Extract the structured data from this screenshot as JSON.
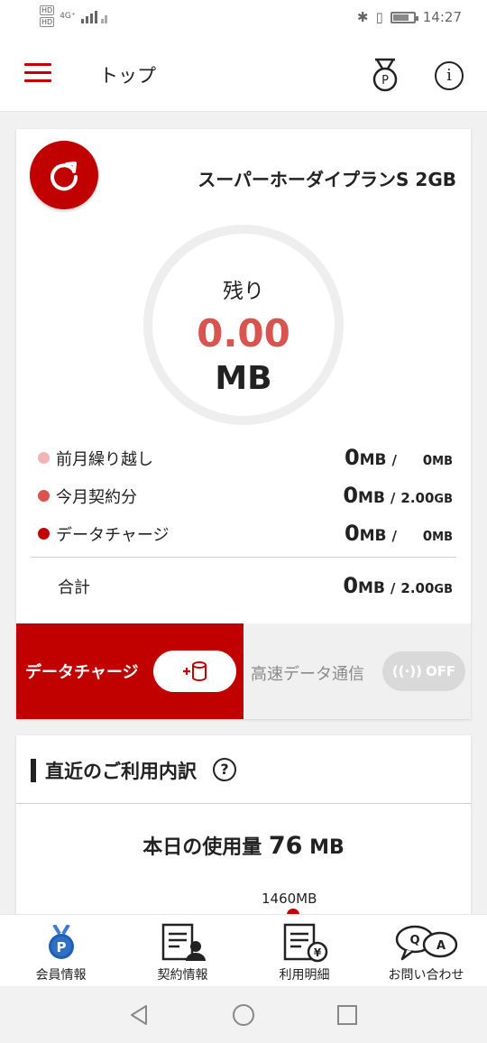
{
  "status_bar": {
    "network": "4G⁺",
    "time": "14:27"
  },
  "header": {
    "title": "トップ"
  },
  "plan": {
    "name": "スーパーホーダイプランS 2GB",
    "remaining_label": "残り",
    "remaining_value": "0.00",
    "remaining_unit": "MB"
  },
  "usage_rows": [
    {
      "label": "前月繰り越し",
      "used": "0",
      "used_unit": "MB",
      "sep": "/",
      "limit": "0",
      "limit_unit": "MB",
      "color": "#f0b6b6"
    },
    {
      "label": "今月契約分",
      "used": "0",
      "used_unit": "MB",
      "sep": "/",
      "limit": "2.00",
      "limit_unit": "GB",
      "color": "#d9534f"
    },
    {
      "label": "データチャージ",
      "used": "0",
      "used_unit": "MB",
      "sep": "/",
      "limit": "0",
      "limit_unit": "MB",
      "color": "#c10000"
    }
  ],
  "total": {
    "label": "合計",
    "used": "0",
    "used_unit": "MB",
    "sep": "/",
    "limit": "2.00",
    "limit_unit": "GB"
  },
  "actions": {
    "charge_label": "データチャージ",
    "speed_label": "高速データ通信",
    "speed_toggle": "OFF"
  },
  "recent": {
    "title": "直近のご利用内訳",
    "help": "?",
    "today_prefix": "本日の使用量",
    "today_value": "76",
    "today_unit": "MB",
    "chart_max_label": "1460MB"
  },
  "bottom_nav": [
    {
      "label": "会員情報",
      "icon": "member-badge-icon"
    },
    {
      "label": "契約情報",
      "icon": "contract-icon"
    },
    {
      "label": "利用明細",
      "icon": "bill-icon"
    },
    {
      "label": "お問い合わせ",
      "icon": "qa-icon"
    }
  ],
  "colors": {
    "brand_red": "#c10000",
    "accent_red": "#d9534f"
  }
}
